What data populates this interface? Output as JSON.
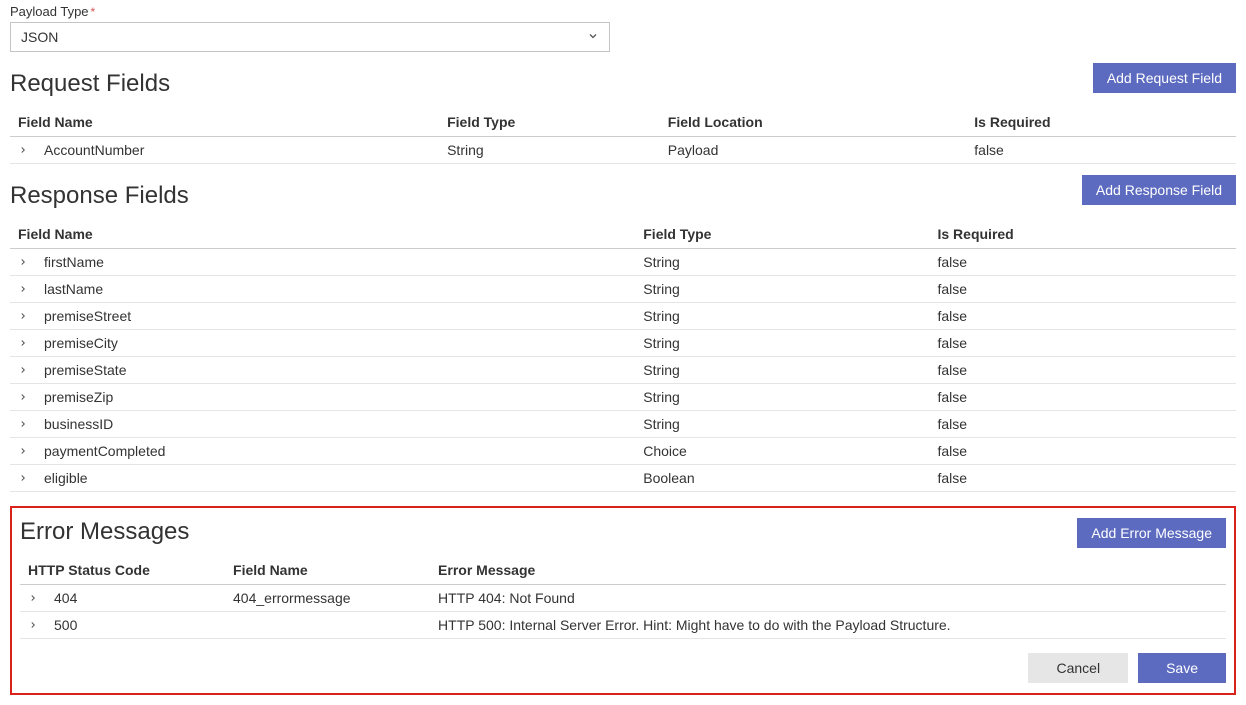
{
  "payloadType": {
    "label": "Payload Type",
    "required": "*",
    "value": "JSON"
  },
  "requestSection": {
    "title": "Request Fields",
    "addButton": "Add Request Field",
    "headers": {
      "name": "Field Name",
      "type": "Field Type",
      "location": "Field Location",
      "required": "Is Required"
    },
    "rows": [
      {
        "name": "AccountNumber",
        "type": "String",
        "location": "Payload",
        "required": "false"
      }
    ]
  },
  "responseSection": {
    "title": "Response Fields",
    "addButton": "Add Response Field",
    "headers": {
      "name": "Field Name",
      "type": "Field Type",
      "required": "Is Required"
    },
    "rows": [
      {
        "name": "firstName",
        "type": "String",
        "required": "false"
      },
      {
        "name": "lastName",
        "type": "String",
        "required": "false"
      },
      {
        "name": "premiseStreet",
        "type": "String",
        "required": "false"
      },
      {
        "name": "premiseCity",
        "type": "String",
        "required": "false"
      },
      {
        "name": "premiseState",
        "type": "String",
        "required": "false"
      },
      {
        "name": "premiseZip",
        "type": "String",
        "required": "false"
      },
      {
        "name": "businessID",
        "type": "String",
        "required": "false"
      },
      {
        "name": "paymentCompleted",
        "type": "Choice",
        "required": "false"
      },
      {
        "name": "eligible",
        "type": "Boolean",
        "required": "false"
      }
    ]
  },
  "errorSection": {
    "title": "Error Messages",
    "addButton": "Add Error Message",
    "headers": {
      "code": "HTTP Status Code",
      "field": "Field Name",
      "message": "Error Message"
    },
    "rows": [
      {
        "code": "404",
        "field": "404_errormessage",
        "message": "HTTP 404: Not Found"
      },
      {
        "code": "500",
        "field": "",
        "message": "HTTP 500: Internal Server Error. Hint: Might have to do with the Payload Structure."
      }
    ]
  },
  "footer": {
    "cancel": "Cancel",
    "save": "Save"
  }
}
